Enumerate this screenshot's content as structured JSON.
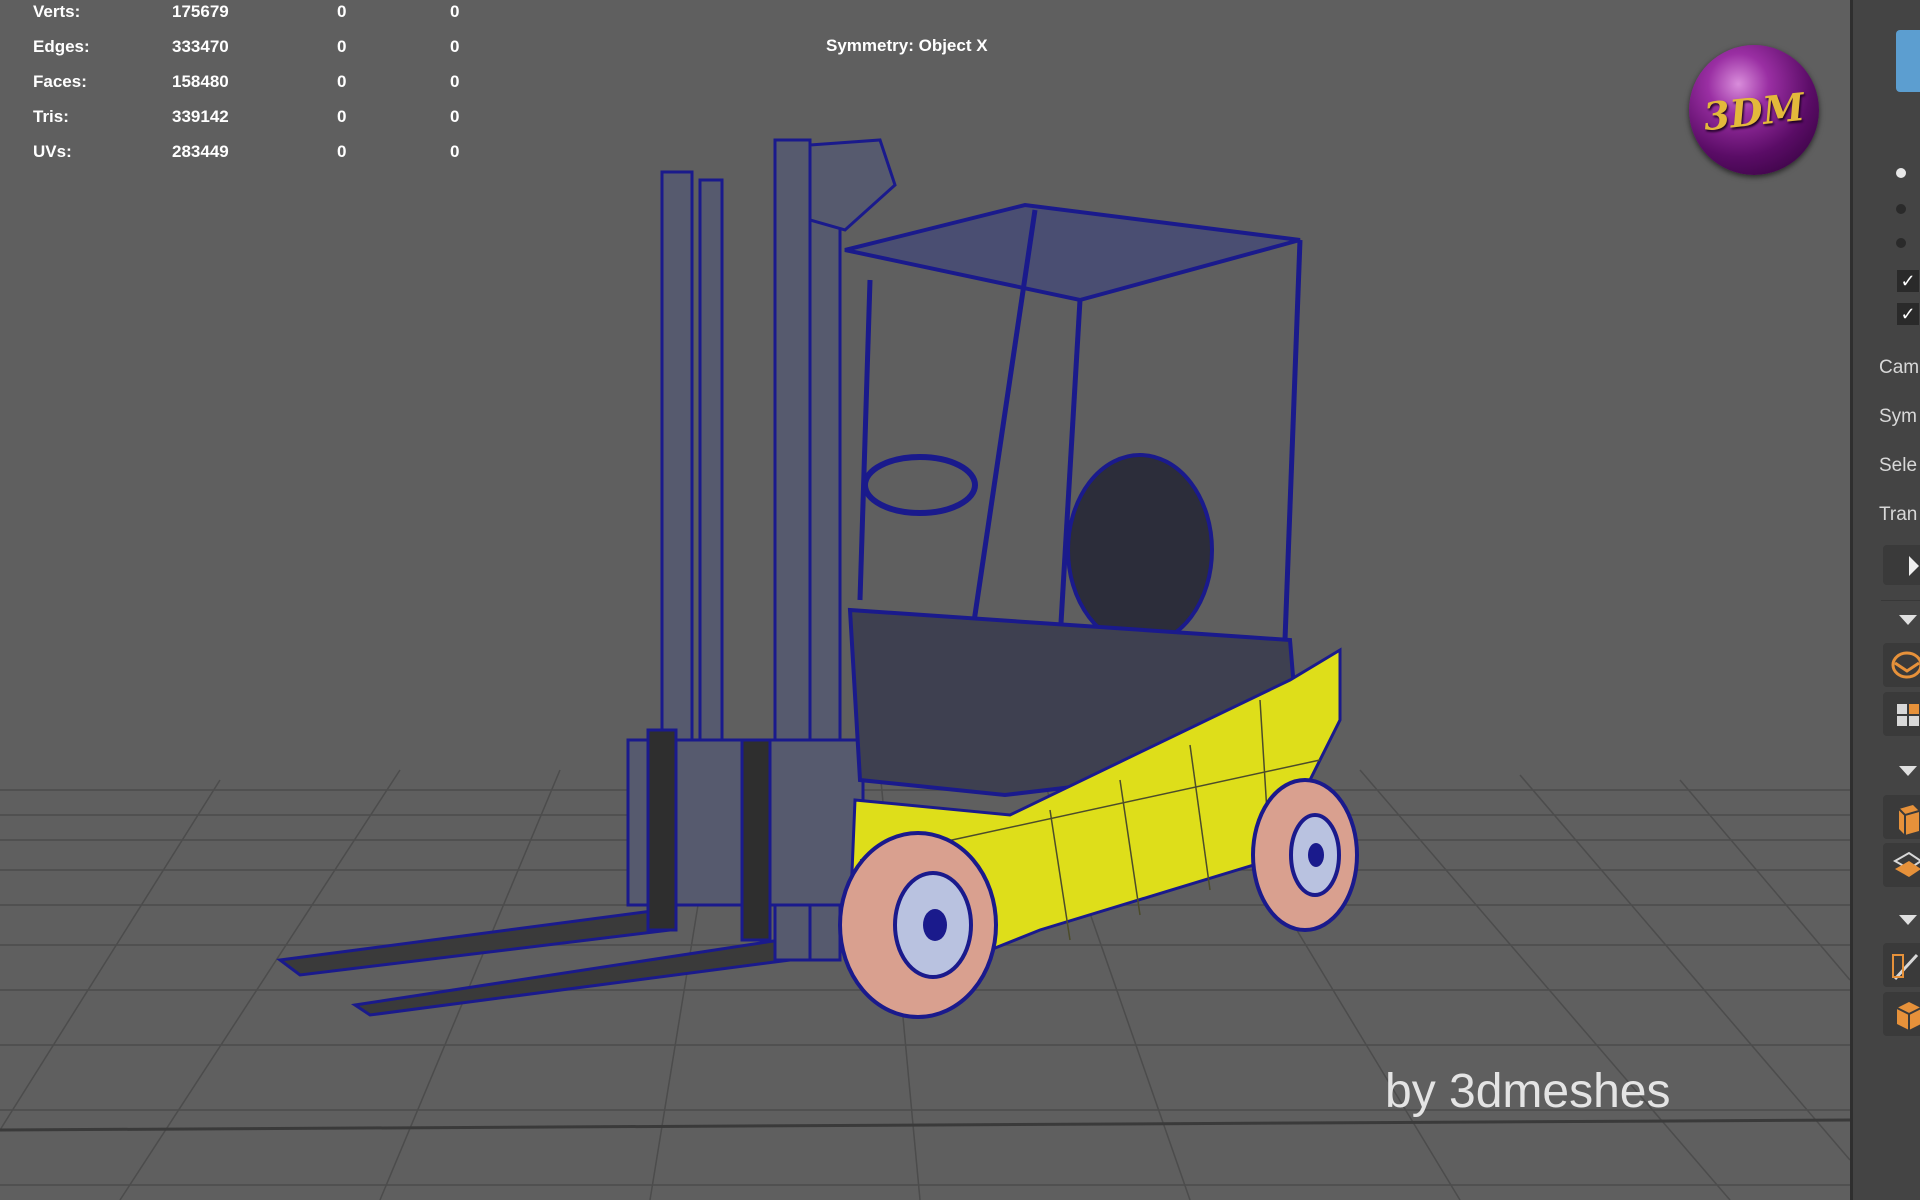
{
  "stats": [
    {
      "label": "Verts:",
      "v1": "175679",
      "v2": "0",
      "v3": "0"
    },
    {
      "label": "Edges:",
      "v1": "333470",
      "v2": "0",
      "v3": "0"
    },
    {
      "label": "Faces:",
      "v1": "158480",
      "v2": "0",
      "v3": "0"
    },
    {
      "label": "Tris:",
      "v1": "339142",
      "v2": "0",
      "v3": "0"
    },
    {
      "label": "UVs:",
      "v1": "283449",
      "v2": "0",
      "v3": "0"
    }
  ],
  "symmetry": "Symmetry: Object X",
  "logo_text": "3DM",
  "watermark": "by 3dmeshes",
  "panel": {
    "labels": [
      "Cam",
      "Sym",
      "Sele",
      "Tran"
    ]
  },
  "colors": {
    "viewport_bg": "#5f5f5f",
    "wireframe": "#1a1a8c",
    "body_yellow": "#dede1a",
    "tire_pink": "#d9a08f",
    "panel_bg": "#444444",
    "accent_blue": "#5c9ed0",
    "icon_orange": "#e6913a"
  }
}
